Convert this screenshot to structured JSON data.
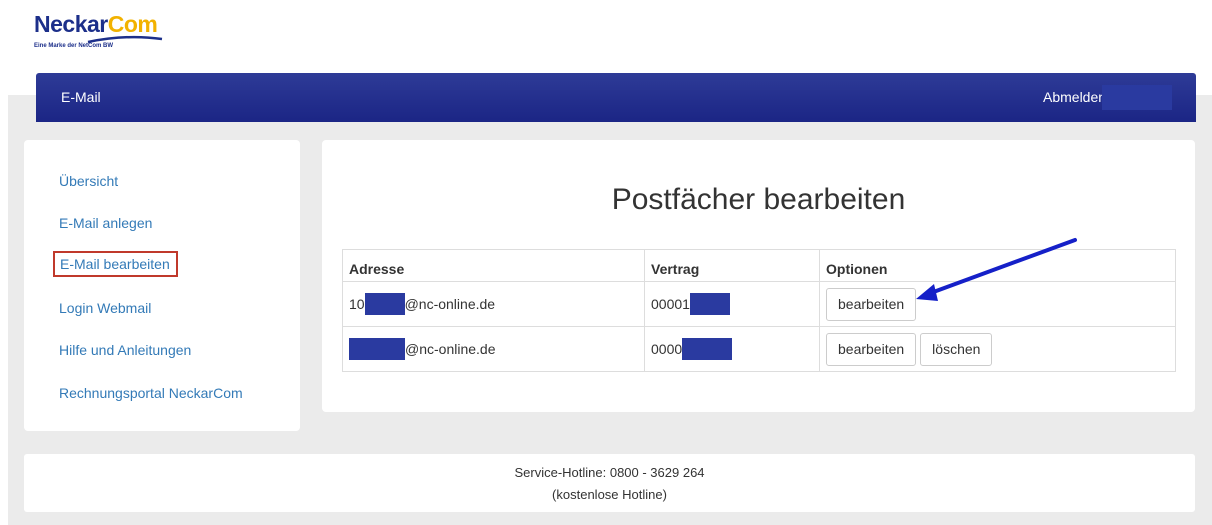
{
  "brand": {
    "name_part1": "Neckar",
    "name_part2": "Com",
    "tagline": "Eine Marke der NetCom BW"
  },
  "colors": {
    "navbar": "#1e2a8c",
    "link": "#337ab7",
    "highlight_box": "#c0392b",
    "arrow": "#1520c8",
    "redaction": "#2a3aa0"
  },
  "navbar": {
    "title": "E-Mail",
    "logout_label": "Abmelden"
  },
  "sidebar": {
    "items": [
      {
        "label": "Übersicht"
      },
      {
        "label": "E-Mail anlegen"
      },
      {
        "label": "E-Mail bearbeiten"
      },
      {
        "label": "Login Webmail"
      },
      {
        "label": "Hilfe und Anleitungen"
      },
      {
        "label": "Rechnungsportal NeckarCom"
      }
    ]
  },
  "main": {
    "title": "Postfächer bearbeiten",
    "table": {
      "headers": [
        "Adresse",
        "Vertrag",
        "Optionen"
      ],
      "rows": [
        {
          "address_prefix": "10",
          "address_suffix": "@nc-online.de",
          "contract_prefix": "00001",
          "actions": [
            "bearbeiten"
          ]
        },
        {
          "address_prefix": "",
          "address_suffix": "@nc-online.de",
          "contract_prefix": "0000",
          "actions": [
            "bearbeiten",
            "löschen"
          ]
        }
      ]
    }
  },
  "footer": {
    "hotline": "Service-Hotline: 0800 - 3629 264",
    "note": "(kostenlose Hotline)"
  }
}
